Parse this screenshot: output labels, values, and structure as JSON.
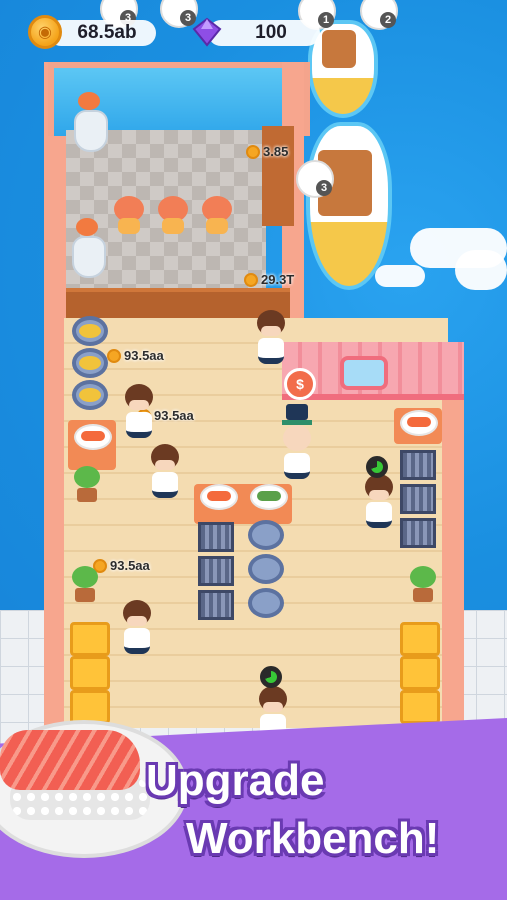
{
  "hud": {
    "coins": "68.5ab",
    "gems": "100",
    "icons": {
      "coin": "coin-icon",
      "gem": "purple-gem-icon"
    }
  },
  "money_labels": {
    "dining_top": "3.85",
    "counter": "29.3T",
    "station_a": "93.5aa",
    "station_b": "93.5aa",
    "station_c": "93.5aa"
  },
  "order_bubbles": {
    "top_1": "3",
    "top_2": "3",
    "top_3": "1",
    "top_4": "2",
    "boat_order": "3"
  },
  "cash_bubble": "$",
  "banner": {
    "line1": "Upgrade",
    "line2": "Workbench!"
  },
  "colors": {
    "ocean": "#1a8fe0",
    "banner": "#a56be8",
    "wall": "#f7a68e",
    "floor": "#f4dcb1"
  }
}
